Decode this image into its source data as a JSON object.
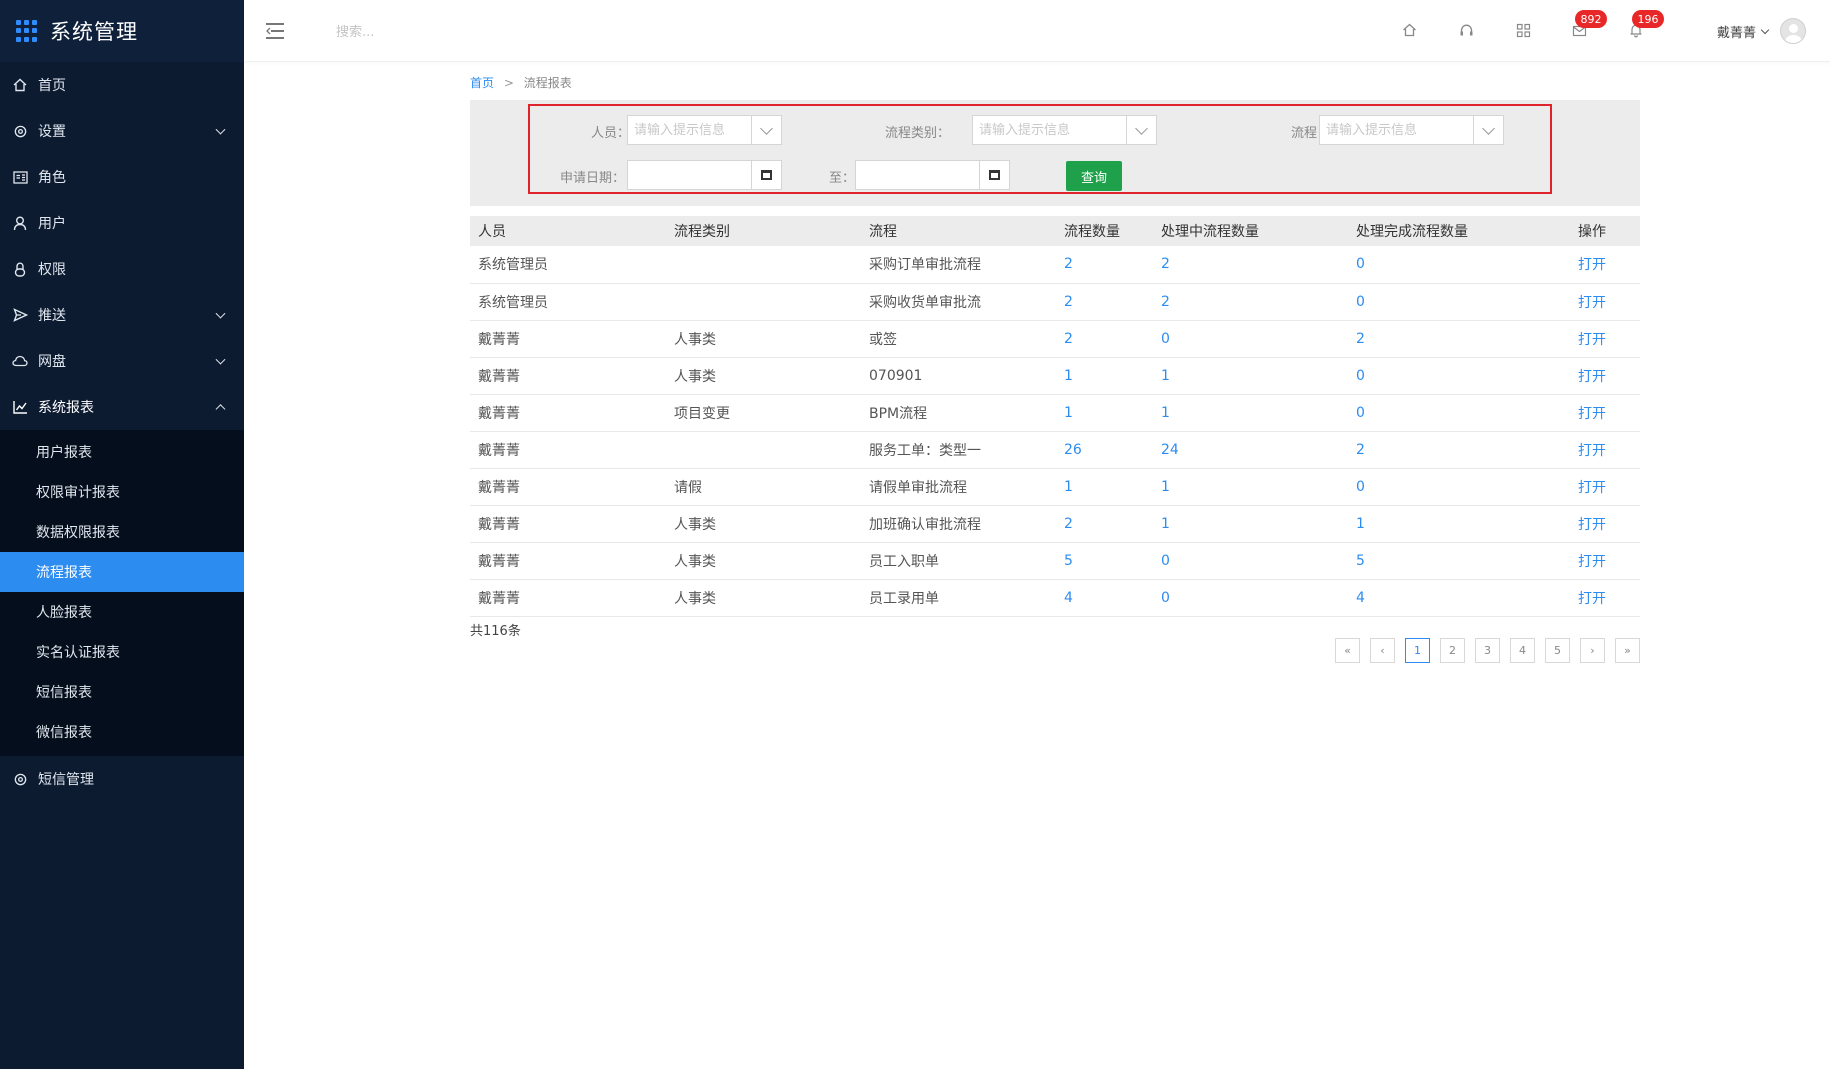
{
  "app": {
    "title": "系统管理"
  },
  "sidebar": {
    "items": [
      {
        "label": "首页",
        "icon": "home-icon",
        "expandable": false
      },
      {
        "label": "设置",
        "icon": "gear-icon",
        "expandable": true
      },
      {
        "label": "角色",
        "icon": "id-card-icon",
        "expandable": false
      },
      {
        "label": "用户",
        "icon": "user-icon",
        "expandable": false
      },
      {
        "label": "权限",
        "icon": "lock-icon",
        "expandable": false
      },
      {
        "label": "推送",
        "icon": "send-icon",
        "expandable": true
      },
      {
        "label": "网盘",
        "icon": "cloud-icon",
        "expandable": true
      },
      {
        "label": "系统报表",
        "icon": "line-chart-icon",
        "expandable": true,
        "open": true
      }
    ],
    "submenu": [
      "用户报表",
      "权限审计报表",
      "数据权限报表",
      "流程报表",
      "人脸报表",
      "实名认证报表",
      "短信报表",
      "微信报表"
    ],
    "submenu_active_index": 3,
    "after_items": [
      {
        "label": "短信管理",
        "icon": "gear-icon"
      }
    ],
    "colors": {
      "bg": "#0d1b31",
      "submenu_bg": "#050e1c",
      "active": "#2d8cf0"
    }
  },
  "header": {
    "search_placeholder": "搜索...",
    "mail_badge": "892",
    "bell_badge": "196",
    "username": "戴菁菁"
  },
  "breadcrumb": {
    "home": "首页",
    "separator": ">",
    "current": "流程报表"
  },
  "filter": {
    "person_label": "人员：",
    "category_label": "流程类别：",
    "process_label": "流程：",
    "placeholder": "请输入提示信息",
    "date_label": "申请日期：",
    "to_label": "至：",
    "query_button": "查询"
  },
  "table": {
    "headers": [
      "人员",
      "流程类别",
      "流程",
      "流程数量",
      "处理中流程数量",
      "处理完成流程数量",
      "操作"
    ],
    "rows": [
      [
        "系统管理员",
        "",
        "采购订单审批流程",
        "2",
        "2",
        "0",
        "打开"
      ],
      [
        "系统管理员",
        "",
        "采购收货单审批流",
        "2",
        "2",
        "0",
        "打开"
      ],
      [
        "戴菁菁",
        "人事类",
        "或签",
        "2",
        "0",
        "2",
        "打开"
      ],
      [
        "戴菁菁",
        "人事类",
        "070901",
        "1",
        "1",
        "0",
        "打开"
      ],
      [
        "戴菁菁",
        "项目变更",
        "BPM流程",
        "1",
        "1",
        "0",
        "打开"
      ],
      [
        "戴菁菁",
        "",
        "服务工单：类型一",
        "26",
        "24",
        "2",
        "打开"
      ],
      [
        "戴菁菁",
        "请假",
        "请假单审批流程",
        "1",
        "1",
        "0",
        "打开"
      ],
      [
        "戴菁菁",
        "人事类",
        "加班确认审批流程",
        "2",
        "1",
        "1",
        "打开"
      ],
      [
        "戴菁菁",
        "人事类",
        "员工入职单",
        "5",
        "0",
        "5",
        "打开"
      ],
      [
        "戴菁菁",
        "人事类",
        "员工录用单",
        "4",
        "0",
        "4",
        "打开"
      ]
    ]
  },
  "footer": {
    "total": "共116条",
    "pages": [
      "«",
      "‹",
      "1",
      "2",
      "3",
      "4",
      "5",
      "›",
      "»"
    ],
    "current_page": "1"
  }
}
